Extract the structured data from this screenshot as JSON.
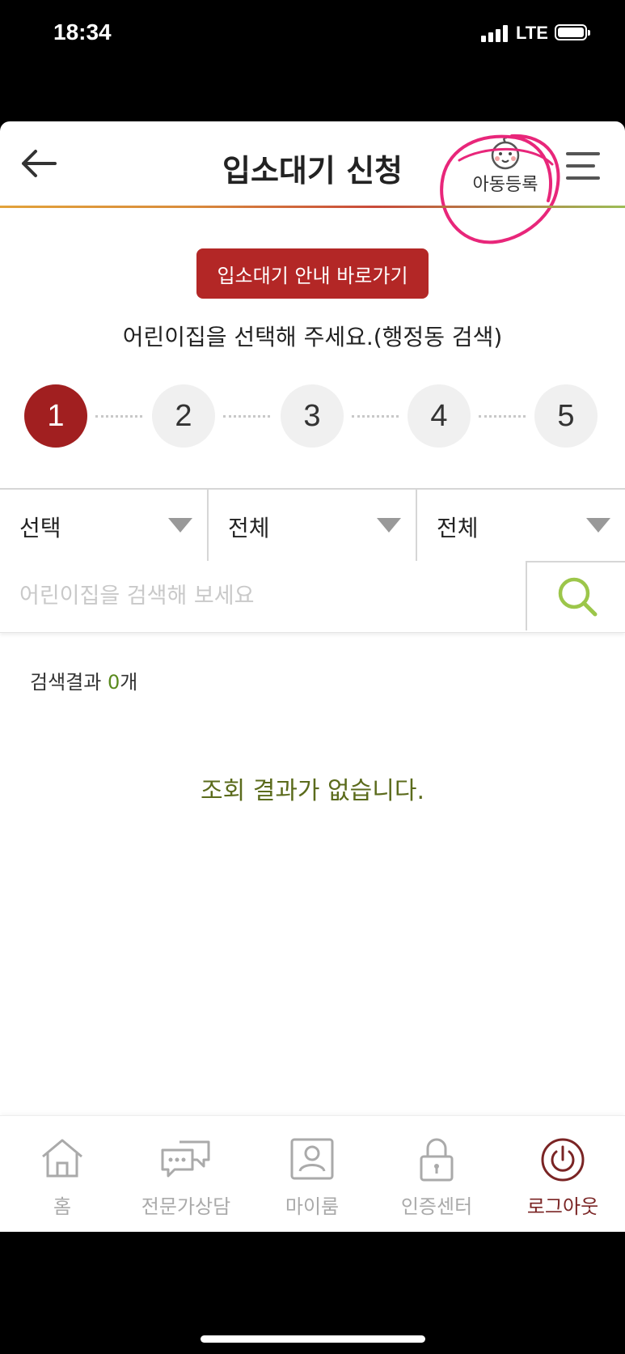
{
  "status_bar": {
    "time": "18:34",
    "network": "LTE"
  },
  "header": {
    "title": "입소대기 신청",
    "child_register_label": "아동등록"
  },
  "guide_button": "입소대기 안내 바로가기",
  "instruction": "어린이집을 선택해 주세요.(행정동 검색)",
  "steps": [
    "1",
    "2",
    "3",
    "4",
    "5"
  ],
  "active_step": 1,
  "filters": [
    {
      "value": "선택"
    },
    {
      "value": "전체"
    },
    {
      "value": "전체"
    }
  ],
  "search": {
    "placeholder": "어린이집을 검색해 보세요",
    "value": ""
  },
  "results": {
    "label": "검색결과 ",
    "count": "0",
    "unit": "개",
    "empty_message": "조회 결과가 없습니다."
  },
  "bottom_nav": [
    {
      "label": "홈",
      "icon": "home-icon"
    },
    {
      "label": "전문가상담",
      "icon": "chat-icon"
    },
    {
      "label": "마이룸",
      "icon": "person-icon"
    },
    {
      "label": "인증센터",
      "icon": "lock-icon"
    },
    {
      "label": "로그아웃",
      "icon": "power-icon"
    }
  ],
  "colors": {
    "accent": "#b32726",
    "step_active": "#a11f20",
    "search_icon": "#9cc64a",
    "logout": "#7a2424"
  }
}
